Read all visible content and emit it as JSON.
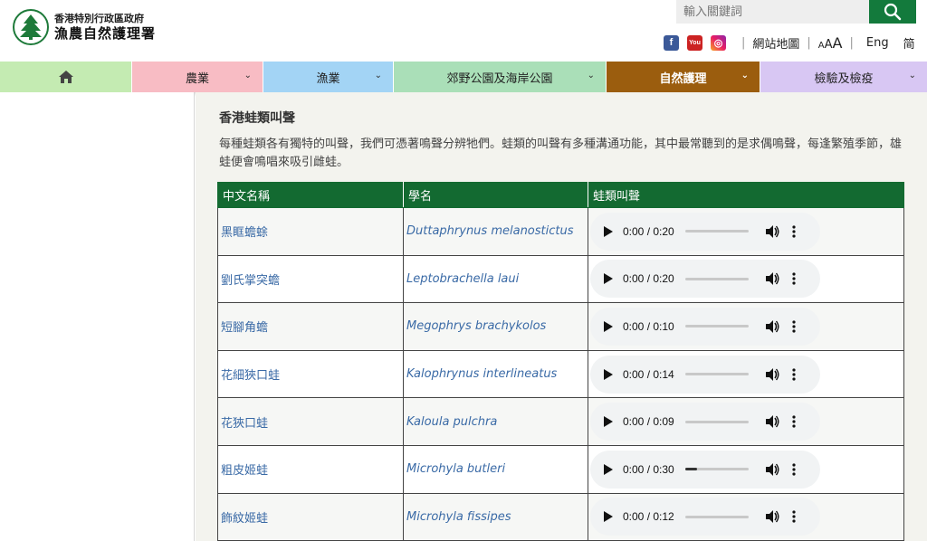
{
  "header": {
    "logo_line1": "香港特別行政區政府",
    "logo_line2": "漁農自然護理署",
    "search_placeholder": "輸入關鍵詞",
    "sitemap": "網站地圖",
    "font_small": "A",
    "font_medium": "A",
    "font_large": "A",
    "lang_eng": "Eng",
    "lang_sc": "简"
  },
  "nav": {
    "items": [
      {
        "label": "",
        "color": "#c4ebb2",
        "icon": "home-icon"
      },
      {
        "label": "農業",
        "color": "#f8bcc4"
      },
      {
        "label": "漁業",
        "color": "#a3d4f5"
      },
      {
        "label": "郊野公園及海岸公園",
        "color": "#aadfb8"
      },
      {
        "label": "自然護理",
        "color": "#9b5d0e",
        "active": true
      },
      {
        "label": "檢驗及檢疫",
        "color": "#d8c7f3"
      }
    ]
  },
  "content": {
    "title": "香港蛙類叫聲",
    "intro": "每種蛙類各有獨特的叫聲，我們可憑著鳴聲分辨牠們。蛙類的叫聲有多種溝通功能，其中最常聽到的是求偶鳴聲，每逢繁殖季節，雄蛙便會鳴唱來吸引雌蛙。"
  },
  "table": {
    "headers": [
      "中文名稱",
      "學名",
      "蛙類叫聲"
    ],
    "rows": [
      {
        "chinese": "黑眶蟾蜍",
        "scientific": "Duttaphrynus melanostictus",
        "time": "0:00 / 0:20",
        "progress": 0
      },
      {
        "chinese": "劉氏掌突蟾",
        "scientific": "Leptobrachella laui",
        "time": "0:00 / 0:20",
        "progress": 0
      },
      {
        "chinese": "短腳角蟾",
        "scientific": "Megophrys brachykolos",
        "time": "0:00 / 0:10",
        "progress": 0
      },
      {
        "chinese": "花細狹口蛙",
        "scientific": "Kalophrynus interlineatus",
        "time": "0:00 / 0:14",
        "progress": 0
      },
      {
        "chinese": "花狹口蛙",
        "scientific": "Kaloula pulchra",
        "time": "0:00 / 0:09",
        "progress": 0
      },
      {
        "chinese": "粗皮姬蛙",
        "scientific": "Microhyla butleri",
        "time": "0:00 / 0:30",
        "progress": 0.18
      },
      {
        "chinese": "飾紋姬蛙",
        "scientific": "Microhyla fissipes",
        "time": "0:00 / 0:12",
        "progress": 0
      }
    ]
  },
  "colors": {
    "brand_green": "#137a3c",
    "table_header": "#136a31",
    "link_blue": "#3a6aa6"
  }
}
